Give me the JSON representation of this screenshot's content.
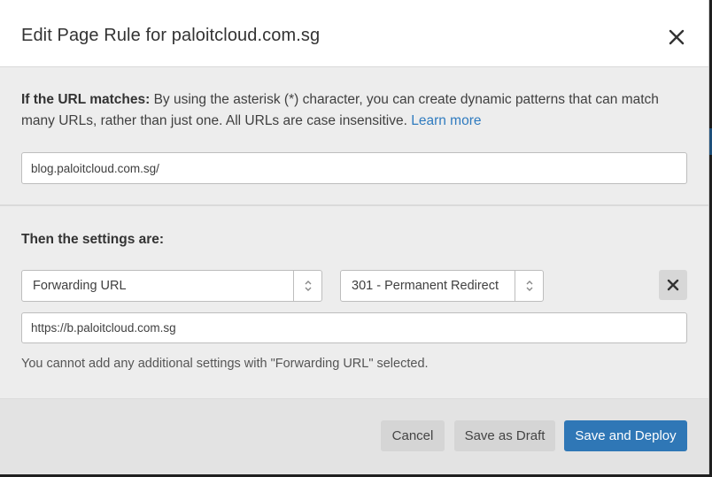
{
  "dialog": {
    "title": "Edit Page Rule for paloitcloud.com.sg"
  },
  "url_match": {
    "heading": "If the URL matches:",
    "description": " By using the asterisk (*) character, you can create dynamic patterns that can match many URLs, rather than just one. All URLs are case insensitive. ",
    "learn_more": "Learn more",
    "value": "blog.paloitcloud.com.sg/"
  },
  "settings": {
    "heading": "Then the settings are:",
    "setting_select": "Forwarding URL",
    "status_select": "301 - Permanent Redirect",
    "destination_url": "https://b.paloitcloud.com.sg",
    "note": "You cannot add any additional settings with \"Forwarding URL\" selected."
  },
  "footer": {
    "cancel_label": "Cancel",
    "draft_label": "Save as Draft",
    "deploy_label": "Save and Deploy"
  },
  "colors": {
    "primary": "#2f77b6",
    "link": "#2f7bbf",
    "section_bg": "#ededed"
  }
}
